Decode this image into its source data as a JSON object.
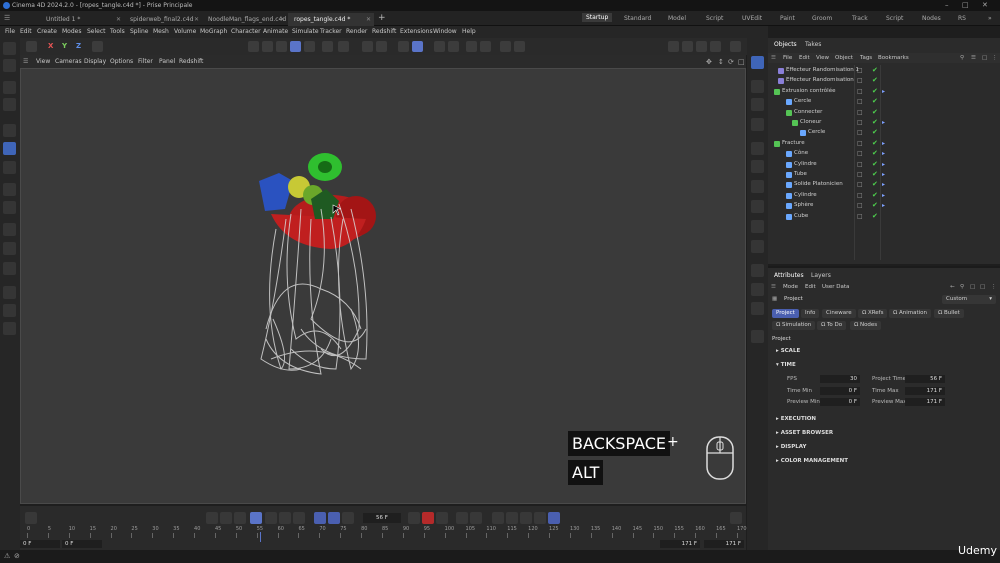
{
  "window": {
    "title": "Cinema 4D 2024.2.0 - [ropes_tangle.c4d *] - Prise Principale"
  },
  "doc_tabs": [
    "Untitled 1 *",
    "spiderweb_final2.c4d",
    "NoodleMan_flags_end.c4d",
    "ropes_tangle.c4d *"
  ],
  "layouts": [
    "Startup",
    "Standard",
    "Model",
    "Script",
    "UVEdit",
    "Paint",
    "Groom",
    "Track",
    "Script",
    "Nodes",
    "RS"
  ],
  "menus": [
    "File",
    "Edit",
    "Create",
    "Modes",
    "Select",
    "Tools",
    "Spline",
    "Mesh",
    "Volume",
    "MoGraph",
    "Character",
    "Animate",
    "Simulate",
    "Tracker",
    "Render",
    "Redshift",
    "Extensions",
    "Window",
    "Help"
  ],
  "toolbar": {
    "axes": [
      "X",
      "Y",
      "Z"
    ]
  },
  "viewport": {
    "menus": [
      "View",
      "Cameras",
      "Display",
      "Options",
      "Filter",
      "Panel",
      "Redshift"
    ],
    "overlay": {
      "key1": "BACKSPACE",
      "plus": "+",
      "key2": "ALT"
    }
  },
  "objects_panel": {
    "tabs": [
      "Objects",
      "Takes"
    ],
    "menus": [
      "File",
      "Edit",
      "View",
      "Object",
      "Tags",
      "Bookmarks"
    ],
    "rows": [
      {
        "name": "Effecteur Randomisation.1",
        "icon": "effector-icon",
        "color": "#8a7fd8"
      },
      {
        "name": "Effecteur Randomisation",
        "icon": "effector-icon",
        "color": "#8a7fd8"
      },
      {
        "name": "Extrusion contrôlée",
        "icon": "sweep-icon",
        "color": "#55c455"
      },
      {
        "name": "Cercle",
        "icon": "circle-spline-icon",
        "color": "#6aa8ff"
      },
      {
        "name": "Connecter",
        "icon": "connect-icon",
        "color": "#55c455"
      },
      {
        "name": "Cloneur",
        "icon": "cloner-icon",
        "color": "#55c455"
      },
      {
        "name": "Cercle",
        "icon": "circle-spline-icon",
        "color": "#6aa8ff"
      },
      {
        "name": "Fracture",
        "icon": "fracture-icon",
        "color": "#55c455"
      },
      {
        "name": "Cône",
        "icon": "cone-icon",
        "color": "#6aa8ff"
      },
      {
        "name": "Cylindre",
        "icon": "cylinder-icon",
        "color": "#6aa8ff"
      },
      {
        "name": "Tube",
        "icon": "tube-icon",
        "color": "#6aa8ff"
      },
      {
        "name": "Solide Platonicien",
        "icon": "platonic-icon",
        "color": "#6aa8ff"
      },
      {
        "name": "Cylindre",
        "icon": "cylinder-icon",
        "color": "#6aa8ff"
      },
      {
        "name": "Sphère",
        "icon": "sphere-icon",
        "color": "#6aa8ff"
      },
      {
        "name": "Cube",
        "icon": "cube-icon",
        "color": "#6aa8ff"
      }
    ]
  },
  "attributes_panel": {
    "tabs": [
      "Attributes",
      "Layers"
    ],
    "menus": [
      "Mode",
      "Edit",
      "User Data"
    ],
    "object_label": "Project",
    "preset": "Custom",
    "buttons_row1": [
      "Project",
      "Info",
      "Cineware",
      "Ω XRefs",
      "Ω Animation",
      "Ω Bullet"
    ],
    "buttons_row2": [
      "Ω Simulation",
      "Ω To Do",
      "Ω Nodes"
    ],
    "section_title": "Project",
    "sections": [
      "SCALE",
      "TIME",
      "EXECUTION",
      "ASSET BROWSER",
      "DISPLAY",
      "COLOR MANAGEMENT"
    ],
    "time": {
      "fps_label": "FPS",
      "fps": "30",
      "project_time_label": "Project Time",
      "project_time": "56 F",
      "time_min_label": "Time Min",
      "time_min": "0 F",
      "time_max_label": "Time Max",
      "time_max": "171 F",
      "preview_min_label": "Preview Min",
      "preview_min": "0 F",
      "preview_max_label": "Preview Max",
      "preview_max": "171 F"
    }
  },
  "timeline": {
    "ticks": [
      "0",
      "5",
      "10",
      "15",
      "20",
      "25",
      "30",
      "35",
      "40",
      "45",
      "50",
      "55",
      "60",
      "65",
      "70",
      "75",
      "80",
      "85",
      "90",
      "95",
      "100",
      "105",
      "110",
      "115",
      "120",
      "125",
      "130",
      "135",
      "140",
      "145",
      "150",
      "155",
      "160",
      "165",
      "170"
    ],
    "current_frame": "56 F",
    "start_field": "0 F",
    "start_field2": "0 F",
    "end_field": "171 F",
    "end_field2": "171 F"
  },
  "watermark": "Udemy"
}
